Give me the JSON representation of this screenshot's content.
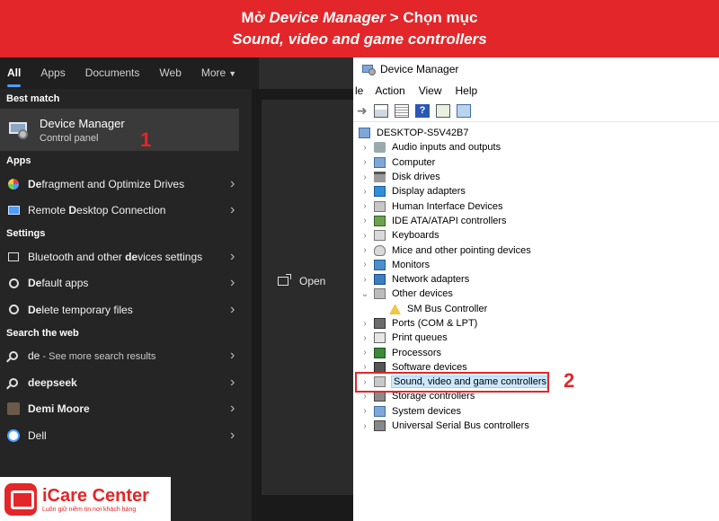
{
  "banner": {
    "line1_prefix": "Mở ",
    "line1_italic": "Device Manager",
    "line1_suffix": " > Chọn mục",
    "line2": "Sound, video and game controllers"
  },
  "search": {
    "tabs": [
      "All",
      "Apps",
      "Documents",
      "Web",
      "More"
    ],
    "best_match_label": "Best match",
    "best_match": {
      "title": "Device Manager",
      "subtitle": "Control panel",
      "icon": "device-manager-icon"
    },
    "step_number": "1",
    "apps_label": "Apps",
    "apps": [
      {
        "prefix": "De",
        "rest": "fragment and Optimize Drives",
        "icon": "defrag-icon"
      },
      {
        "prefix": "Remote ",
        "bold": "D",
        "rest": "esktop Connection",
        "icon": "remote-desktop-icon"
      }
    ],
    "settings_label": "Settings",
    "settings": [
      {
        "prefix": "Bluetooth and other ",
        "bold": "de",
        "rest": "vices settings",
        "icon": "bluetooth-devices-icon"
      },
      {
        "prefix": "",
        "bold": "De",
        "rest": "fault apps",
        "icon": "gear-icon"
      },
      {
        "prefix": "",
        "bold": "De",
        "rest": "lete temporary files",
        "icon": "gear-icon"
      }
    ],
    "web_label": "Search the web",
    "web": [
      {
        "main": "de",
        "sub": " - See more search results",
        "icon": "search-icon"
      },
      {
        "main": "deepseek",
        "sub": "",
        "icon": "search-icon"
      },
      {
        "main": "Demi Moore",
        "sub": "",
        "icon": "avatar-icon"
      },
      {
        "main": "Dell",
        "sub": "",
        "icon": "dell-icon"
      }
    ],
    "preview": {
      "open_label": "Open"
    }
  },
  "logo": {
    "name": "iCare Center",
    "tagline": "Luôn giữ niềm tin nơi khách hàng",
    "color": "#e3262a"
  },
  "device_manager": {
    "title": "Device Manager",
    "menu": [
      "le",
      "Action",
      "View",
      "Help"
    ],
    "root": "DESKTOP-S5V42B7",
    "categories": [
      "Audio inputs and outputs",
      "Computer",
      "Disk drives",
      "Display adapters",
      "Human Interface Devices",
      "IDE ATA/ATAPI controllers",
      "Keyboards",
      "Mice and other pointing devices",
      "Monitors",
      "Network adapters",
      "Other devices",
      "SM Bus Controller",
      "Ports (COM & LPT)",
      "Print queues",
      "Processors",
      "Software devices",
      "Sound, video and game controllers",
      "Storage controllers",
      "System devices",
      "Universal Serial Bus controllers"
    ],
    "step_number": "2",
    "highlight_color": "#cce8ff"
  }
}
